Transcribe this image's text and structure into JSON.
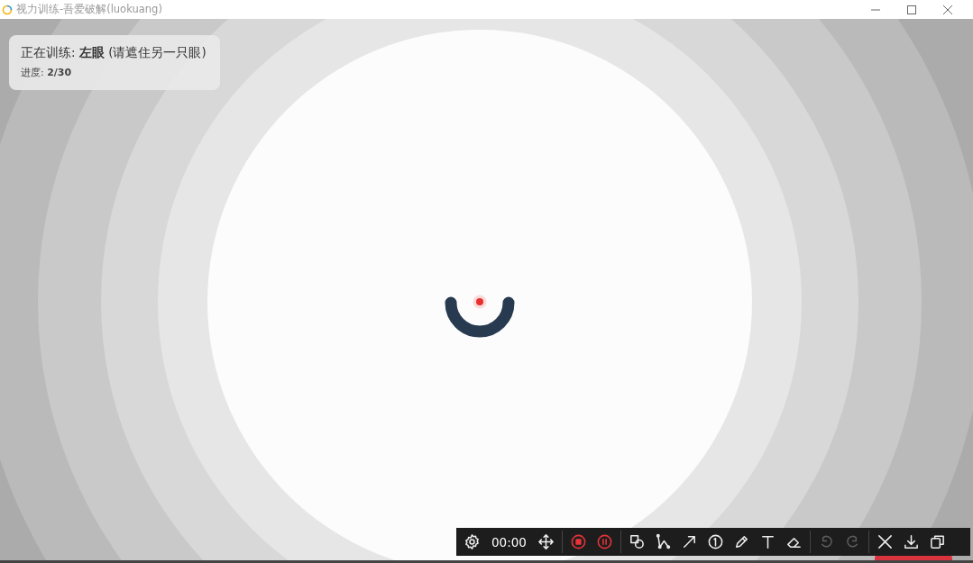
{
  "window": {
    "title": "视力训练-吾爱破解(luokuang)"
  },
  "info": {
    "status": "正在训练: **左眼** (请遮住另一只眼)",
    "progress": "进度: **2/30**"
  },
  "toolbar": {
    "timer": "00:00",
    "groups": [
      [
        {
          "kind": "settings",
          "disabled": false
        },
        {
          "kind": "timer"
        },
        {
          "kind": "move",
          "disabled": false
        }
      ],
      [
        {
          "kind": "record",
          "disabled": false
        },
        {
          "kind": "pause",
          "disabled": false
        }
      ],
      [
        {
          "kind": "shape",
          "disabled": false
        },
        {
          "kind": "polyline",
          "disabled": false
        },
        {
          "kind": "arrow",
          "disabled": false
        },
        {
          "kind": "number",
          "disabled": false
        },
        {
          "kind": "pencil",
          "disabled": false
        },
        {
          "kind": "text",
          "disabled": false
        },
        {
          "kind": "eraser",
          "disabled": false
        }
      ],
      [
        {
          "kind": "undo",
          "disabled": true
        },
        {
          "kind": "redo",
          "disabled": true
        }
      ],
      [
        {
          "kind": "close",
          "disabled": false
        },
        {
          "kind": "download",
          "disabled": false
        },
        {
          "kind": "copy",
          "disabled": false
        }
      ]
    ]
  }
}
